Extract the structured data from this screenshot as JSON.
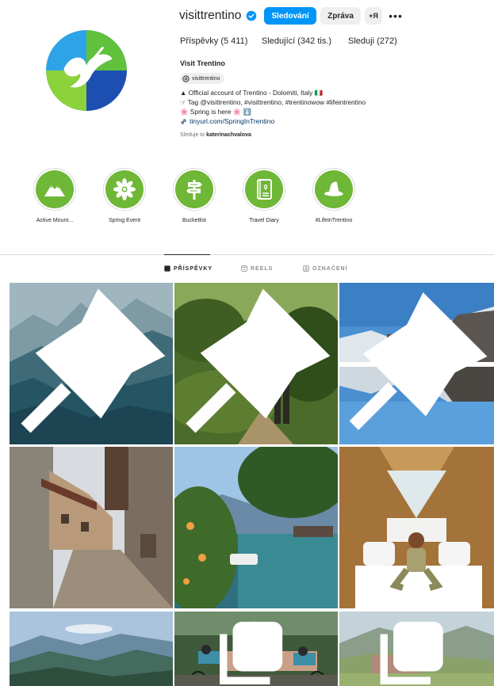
{
  "profile": {
    "username": "visittrentino",
    "follow_label": "Sledování",
    "message_label": "Zpráva",
    "add_user_label": "+Я",
    "more_label": "•••",
    "stats": {
      "posts": "Příspěvky (5 411)",
      "followers": "Sledující (342 tis.)",
      "following": "Sleduji (272)"
    },
    "full_name": "Visit Trentino",
    "threads_handle": "visittrentino",
    "bio_lines": [
      "▲ Official account of Trentino - Dolomiti, Italy 🇮🇹",
      "☞ Tag @visittrentino, #visittrentino, #trentinowow #lifeintrentino",
      "🌸 Spring is here 🌸 ⬇️"
    ],
    "link": "tinyurl.com/SpringInTrentino",
    "followed_by_prefix": "Sleduje to",
    "followed_by_user": "katerinachvalova"
  },
  "highlights": [
    {
      "label": "Active Mount...",
      "icon": "mountain-icon"
    },
    {
      "label": "Spring Event",
      "icon": "edelweiss-icon"
    },
    {
      "label": "Bucketlist",
      "icon": "signpost-icon"
    },
    {
      "label": "Travel Diary",
      "icon": "diary-icon"
    },
    {
      "label": "#LifeInTrentino",
      "icon": "hat-icon"
    }
  ],
  "tabs": [
    {
      "label": "PŘÍSPĚVKY",
      "icon": "grid-icon",
      "active": true
    },
    {
      "label": "REELS",
      "icon": "reels-icon",
      "active": false
    },
    {
      "label": "OZNAČENÍ",
      "icon": "tagged-icon",
      "active": false
    }
  ],
  "colors": {
    "accent": "#0095f6",
    "highlight_green": "#6fb736",
    "link": "#00376b"
  },
  "posts": [
    {
      "name": "post-mountain-silhouette",
      "icon": "pin-icon"
    },
    {
      "name": "post-forest-woman",
      "icon": "pin-icon"
    },
    {
      "name": "post-lake-reflection",
      "icon": "pin-icon"
    },
    {
      "name": "post-village-alley",
      "icon": null
    },
    {
      "name": "post-lake-harbor",
      "icon": null
    },
    {
      "name": "post-cabin-woman",
      "icon": null
    },
    {
      "name": "post-mountain-valley",
      "icon": null
    },
    {
      "name": "post-cyclists-church",
      "icon": "carousel-icon"
    },
    {
      "name": "post-valley-castle",
      "icon": "carousel-icon"
    }
  ]
}
